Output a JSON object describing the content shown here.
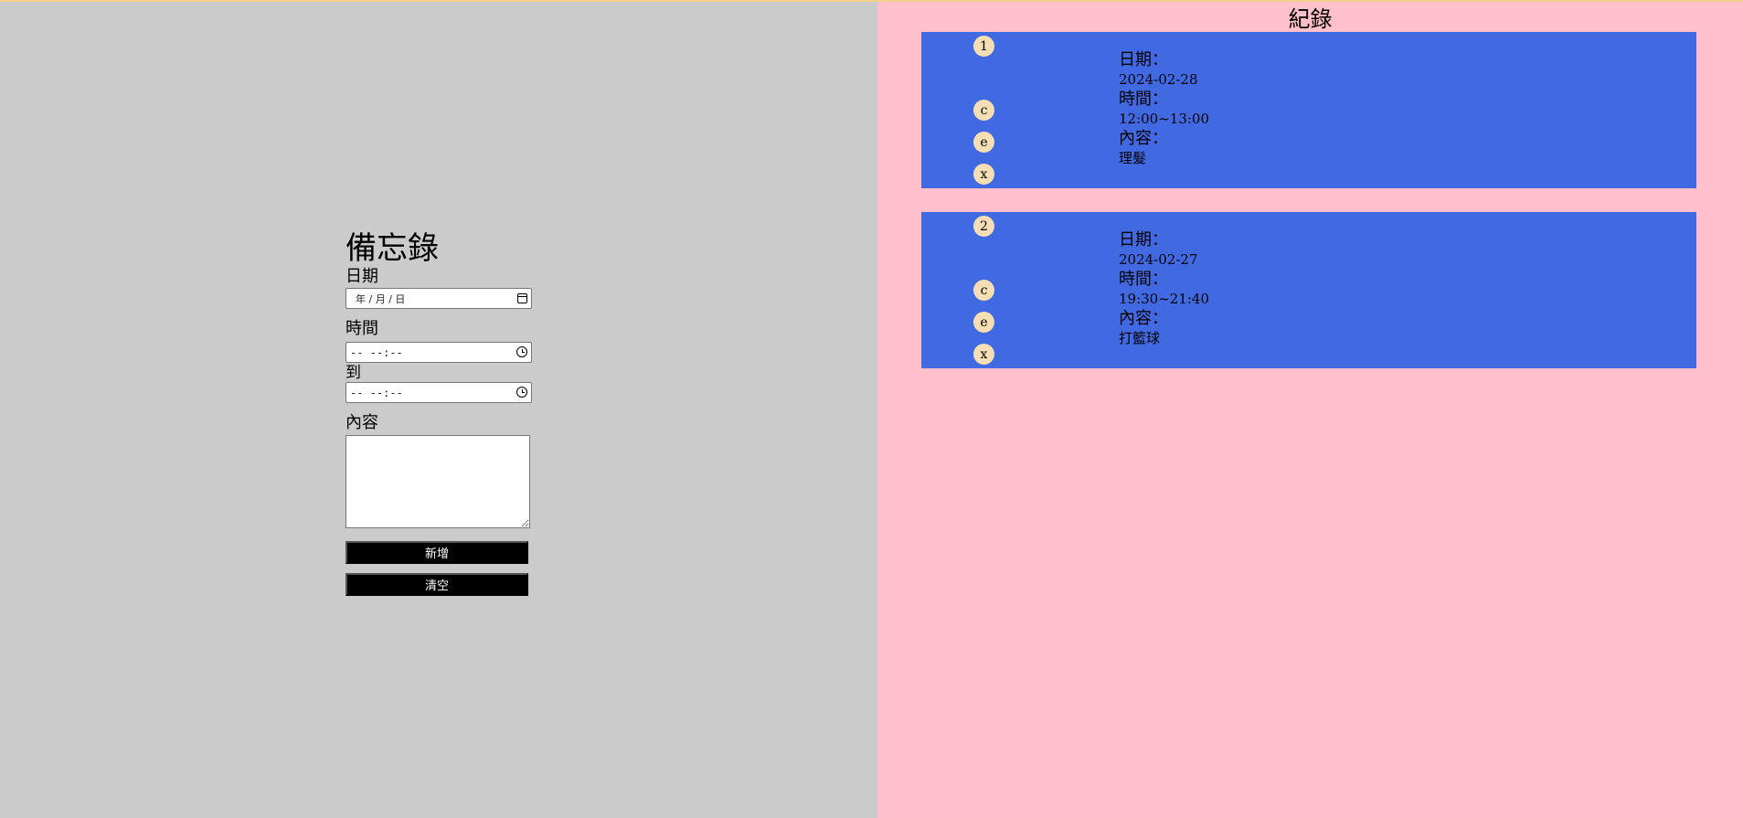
{
  "form": {
    "title": "備忘錄",
    "date_label": "日期",
    "date_placeholder": "年 / 月 / 日",
    "time_label": "時間",
    "start_time_placeholder": "-- --:--",
    "to_label": "到",
    "end_time_placeholder": "-- --:--",
    "content_label": "內容",
    "add_button": "新增",
    "clear_button": "清空"
  },
  "records": {
    "title": "紀錄",
    "date_key": "日期：",
    "time_key": "時間：",
    "content_key": "內容：",
    "actions": {
      "copy": "c",
      "edit": "e",
      "delete": "x"
    },
    "items": [
      {
        "index": "1",
        "date": "2024-02-28",
        "time": "12:00~13:00",
        "content": "理髮"
      },
      {
        "index": "2",
        "date": "2024-02-27",
        "time": "19:30~21:40",
        "content": "打籃球"
      }
    ]
  },
  "colors": {
    "left_bg": "#cbcbcb",
    "right_bg": "#ffc0cb",
    "card_bg": "#4169e1",
    "circle_bg": "#f5deb3",
    "button_bg": "#000000",
    "top_border": "#f5d08a"
  }
}
